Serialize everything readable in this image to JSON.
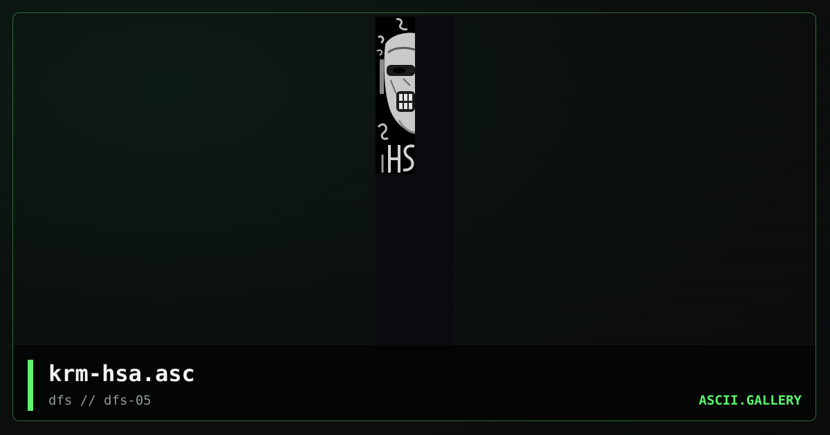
{
  "card": {
    "title": "krm-hsa.asc",
    "subtitle": "dfs // dfs-05",
    "brand": "ASCII.GALLERY"
  },
  "colors": {
    "accent": "#5df26e",
    "frame_border": "#2f6a36",
    "background": "#0a0d0c",
    "info_bar": "#040605",
    "title_text": "#f4f4f4",
    "subtitle_text": "#8f9a92"
  },
  "art": {
    "icon": "ascii-art-thumbnail"
  }
}
